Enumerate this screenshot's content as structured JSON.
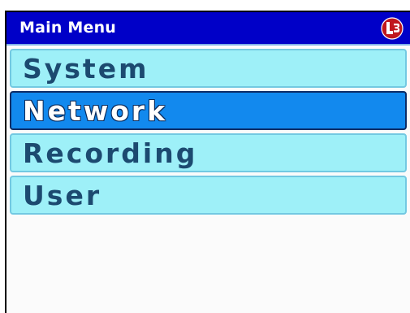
{
  "header": {
    "title": "Main Menu",
    "logo_icon": "l3-logo-icon",
    "logo_color": "#c0161d"
  },
  "menu": {
    "selected_index": 1,
    "items": [
      {
        "label": "System"
      },
      {
        "label": "Network"
      },
      {
        "label": "Recording"
      },
      {
        "label": "User"
      }
    ]
  },
  "colors": {
    "titlebar": "#0000c8",
    "item_bg": "#9ef0f8",
    "item_selected_bg": "#1289ee",
    "item_text": "#1c4a70",
    "item_selected_text": "#ffffff"
  }
}
